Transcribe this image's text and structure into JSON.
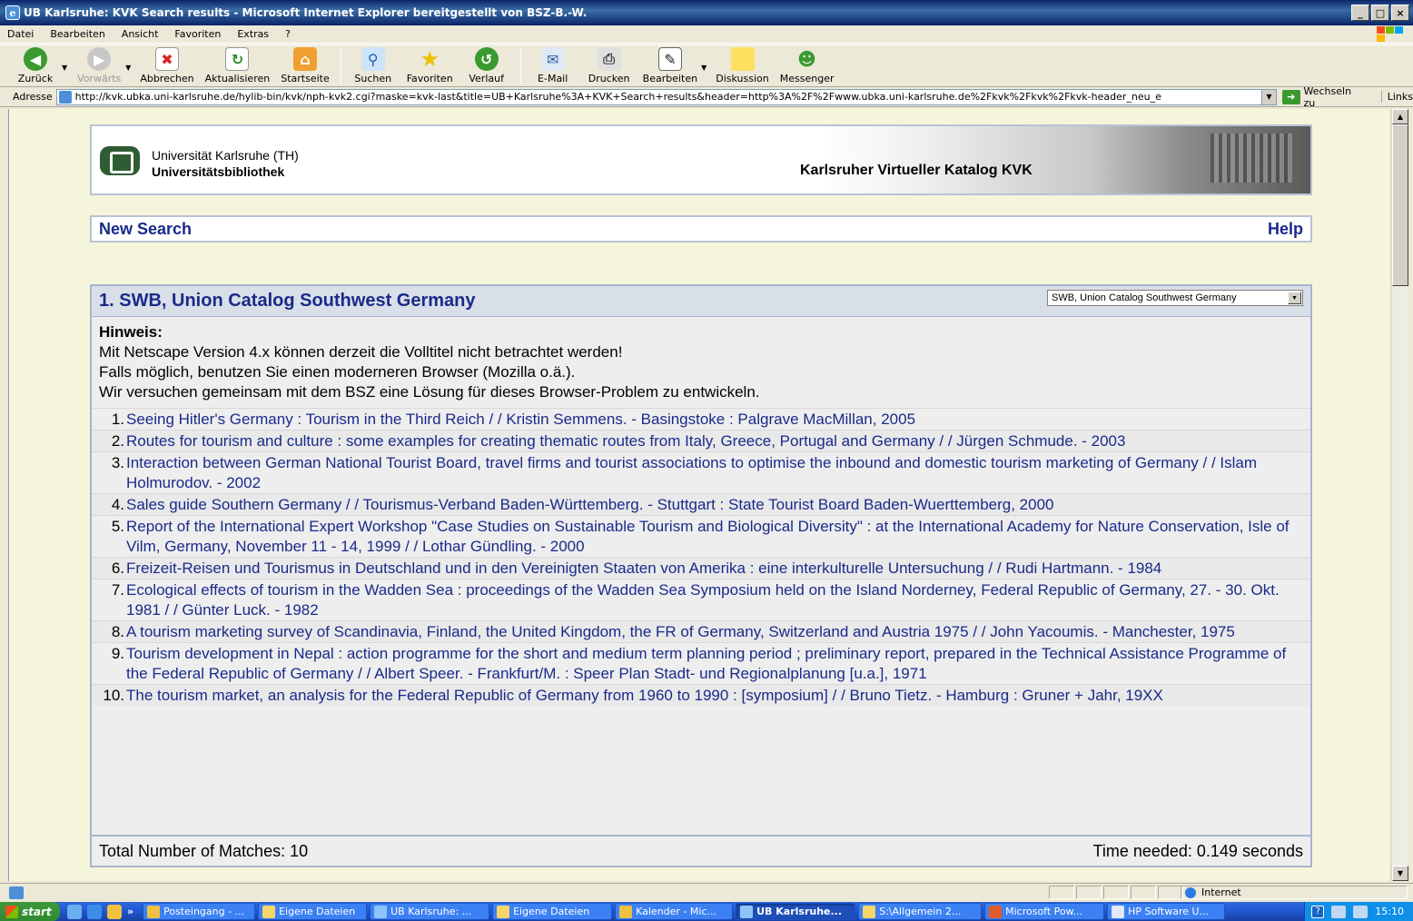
{
  "window": {
    "title": "UB Karlsruhe: KVK Search results - Microsoft Internet Explorer bereitgestellt von BSZ-B.-W.",
    "controls": [
      "_",
      "□",
      "×"
    ]
  },
  "menu": [
    "Datei",
    "Bearbeiten",
    "Ansicht",
    "Favoriten",
    "Extras",
    "?"
  ],
  "toolbar": {
    "back": "Zurück",
    "forward": "Vorwärts",
    "stop": "Abbrechen",
    "refresh": "Aktualisieren",
    "home": "Startseite",
    "search": "Suchen",
    "favorites": "Favoriten",
    "history": "Verlauf",
    "mail": "E-Mail",
    "print": "Drucken",
    "edit": "Bearbeiten",
    "discuss": "Diskussion",
    "messenger": "Messenger"
  },
  "address": {
    "label": "Adresse",
    "url": "http://kvk.ubka.uni-karlsruhe.de/hylib-bin/kvk/nph-kvk2.cgi?maske=kvk-last&title=UB+Karlsruhe%3A+KVK+Search+results&header=http%3A%2F%2Fwww.ubka.uni-karlsruhe.de%2Fkvk%2Fkvk%2Fkvk-header_neu_e",
    "go": "Wechseln zu",
    "links": "Links"
  },
  "banner": {
    "university": "Universität Karlsruhe (TH)",
    "library": "Universitätsbibliothek",
    "catalog_title": "Karlsruher Virtueller Katalog KVK"
  },
  "nav": {
    "new_search": "New Search",
    "help": "Help"
  },
  "results": {
    "heading": "1. SWB, Union Catalog Southwest Germany",
    "catalog_select": "SWB, Union Catalog Southwest Germany",
    "notice_heading": "Hinweis:",
    "notice_lines": [
      "Mit Netscape Version 4.x können derzeit die Volltitel nicht betrachtet werden!",
      "Falls möglich, benutzen Sie einen moderneren Browser (Mozilla o.ä.).",
      "Wir versuchen gemeinsam mit dem BSZ eine Lösung für dieses Browser-Problem zu entwickeln."
    ],
    "items": [
      {
        "num": "1.",
        "text": "Seeing Hitler's Germany : Tourism in the Third Reich / / Kristin Semmens. - Basingstoke : Palgrave MacMillan, 2005"
      },
      {
        "num": "2.",
        "text": "Routes for tourism and culture : some examples for creating thematic routes from Italy, Greece, Portugal and Germany / / Jürgen Schmude. - 2003"
      },
      {
        "num": "3.",
        "text": "Interaction between German National Tourist Board, travel firms and tourist associations to optimise the inbound and domestic tourism marketing of Germany / / Islam Holmurodov. - 2002"
      },
      {
        "num": "4.",
        "text": "Sales guide Southern Germany / / Tourismus-Verband Baden-Württemberg. - Stuttgart : State Tourist Board Baden-Wuerttemberg, 2000"
      },
      {
        "num": "5.",
        "text": "Report of the International Expert Workshop \"Case Studies on Sustainable Tourism and Biological Diversity\" : at the International Academy for Nature Conservation, Isle of Vilm, Germany, November 11 - 14, 1999 / / Lothar Gündling. - 2000"
      },
      {
        "num": "6.",
        "text": "Freizeit-Reisen und Tourismus in Deutschland und in den Vereinigten Staaten von Amerika : eine interkulturelle Untersuchung / / Rudi Hartmann. - 1984"
      },
      {
        "num": "7.",
        "text": "Ecological effects of tourism in the Wadden Sea : proceedings of the Wadden Sea Symposium held on the Island Norderney, Federal Republic of Germany, 27. - 30. Okt. 1981 / / Günter Luck. - 1982"
      },
      {
        "num": "8.",
        "text": "A tourism marketing survey of Scandinavia, Finland, the United Kingdom, the FR of Germany, Switzerland and Austria 1975 / / John Yacoumis. - Manchester, 1975"
      },
      {
        "num": "9.",
        "text": "Tourism development in Nepal : action programme for the short and medium term planning period ; preliminary report, prepared in the Technical Assistance Programme of the Federal Republic of Germany / / Albert Speer. - Frankfurt/M. : Speer Plan Stadt- und Regionalplanung [u.a.], 1971"
      },
      {
        "num": "10.",
        "text": "The tourism market, an analysis for the Federal Republic of Germany from 1960 to 1990 : [symposium] / / Bruno Tietz. - Hamburg : Gruner + Jahr, 19XX"
      }
    ],
    "total": "Total Number of Matches: 10",
    "time": "Time needed: 0.149 seconds"
  },
  "status": {
    "zone": "Internet"
  },
  "taskbar": {
    "start": "start",
    "tasks": [
      "Posteingang - ...",
      "Eigene Dateien",
      "UB Karlsruhe: ...",
      "Eigene Dateien",
      "Kalender - Mic...",
      "UB Karlsruhe...",
      "S:\\Allgemein 2...",
      "Microsoft Pow...",
      "HP Software U..."
    ],
    "clock": "15:10"
  }
}
